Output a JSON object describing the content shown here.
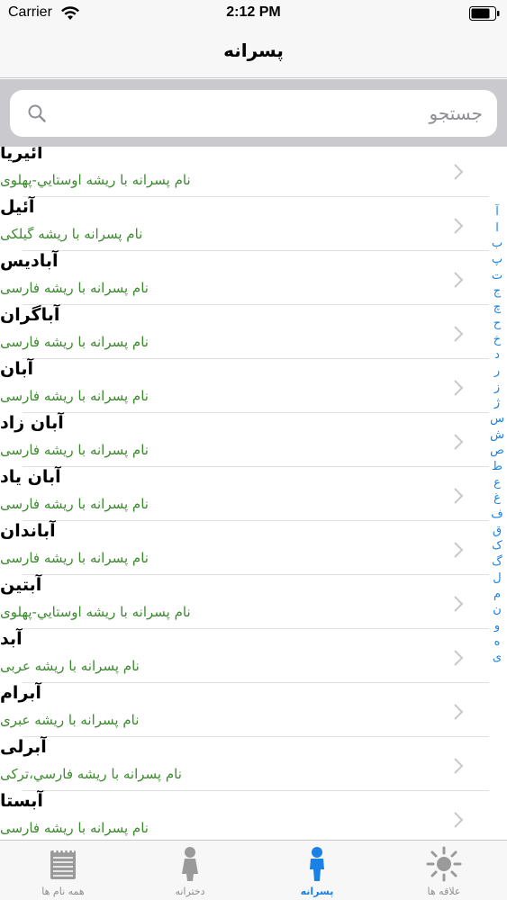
{
  "status_bar": {
    "carrier": "Carrier",
    "time": "2:12 PM"
  },
  "nav": {
    "title": "پسرانه"
  },
  "search": {
    "placeholder": "جستجو"
  },
  "names": [
    {
      "name": "آئیریا",
      "description": "نام پسرانه با ریشه اوستايي-پهلوی"
    },
    {
      "name": "آئیل",
      "description": "نام پسرانه با ریشه گیلکی"
    },
    {
      "name": "آبادیس",
      "description": "نام پسرانه با ریشه فارسی"
    },
    {
      "name": "آباگران",
      "description": "نام پسرانه با ریشه فارسی"
    },
    {
      "name": "آبان",
      "description": "نام پسرانه با ریشه فارسی"
    },
    {
      "name": "آبان زاد",
      "description": "نام پسرانه با ریشه فارسی"
    },
    {
      "name": "آبان یاد",
      "description": "نام پسرانه با ریشه فارسی"
    },
    {
      "name": "آباندان",
      "description": "نام پسرانه با ریشه فارسی"
    },
    {
      "name": "آبتین",
      "description": "نام پسرانه با ریشه اوستايي-پهلوی"
    },
    {
      "name": "آبد",
      "description": "نام پسرانه با ریشه عربی"
    },
    {
      "name": "آبرام",
      "description": "نام پسرانه با ریشه عبری"
    },
    {
      "name": "آبرلی",
      "description": "نام پسرانه با ریشه فارسي،ترکی"
    },
    {
      "name": "آبستا",
      "description": "نام پسرانه با ریشه فارسی"
    }
  ],
  "index_letters": [
    "آ",
    "ا",
    "ب",
    "پ",
    "ت",
    "ج",
    "چ",
    "ح",
    "خ",
    "د",
    "ر",
    "ز",
    "ژ",
    "س",
    "ش",
    "ص",
    "ط",
    "ع",
    "غ",
    "ف",
    "ق",
    "ک",
    "گ",
    "ل",
    "م",
    "ن",
    "و",
    "ه",
    "ی"
  ],
  "tabs": [
    {
      "id": "all",
      "label": "همه نام ها",
      "icon": "notepad-icon",
      "active": false
    },
    {
      "id": "girls",
      "label": "دخترانه",
      "icon": "girl-icon",
      "active": false
    },
    {
      "id": "boys",
      "label": "پسرانه",
      "icon": "boy-icon",
      "active": true
    },
    {
      "id": "favorites",
      "label": "علاقه ها",
      "icon": "sun-icon",
      "active": false
    }
  ],
  "colors": {
    "accent": "#1a82e6",
    "description": "#3c8a2e",
    "inactive_tab": "#8e8e93"
  }
}
